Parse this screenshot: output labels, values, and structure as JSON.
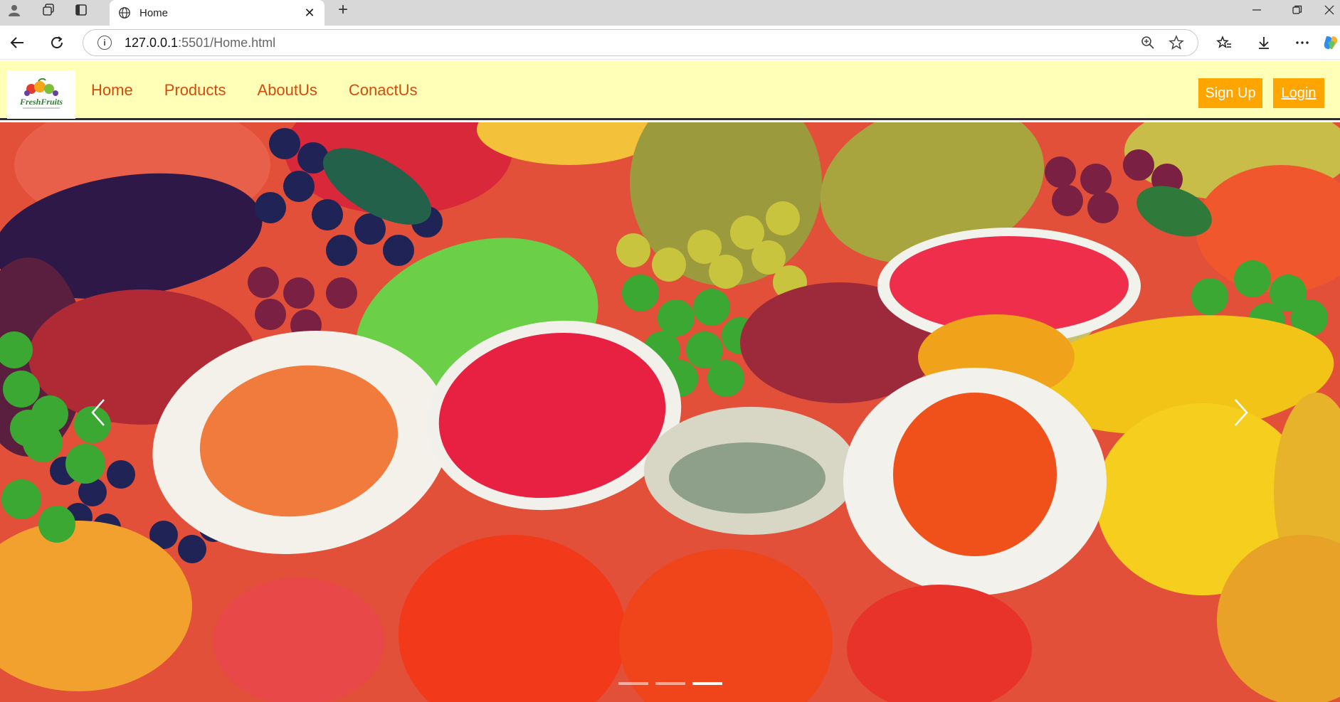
{
  "browser": {
    "tab_title": "Home",
    "url_host": "127.0.0.1",
    "url_rest": ":5501/Home.html"
  },
  "site": {
    "logo_text": "FreshFruits",
    "nav": [
      "Home",
      "Products",
      "AboutUs",
      "ConactUs"
    ],
    "signup_label": "Sign Up",
    "login_label": "Login",
    "accent_color": "#ffa500",
    "nav_text_color": "#d44b0c",
    "navbar_bg": "#ffffb8"
  },
  "carousel": {
    "slide_count": 3,
    "active_slide": 3
  }
}
